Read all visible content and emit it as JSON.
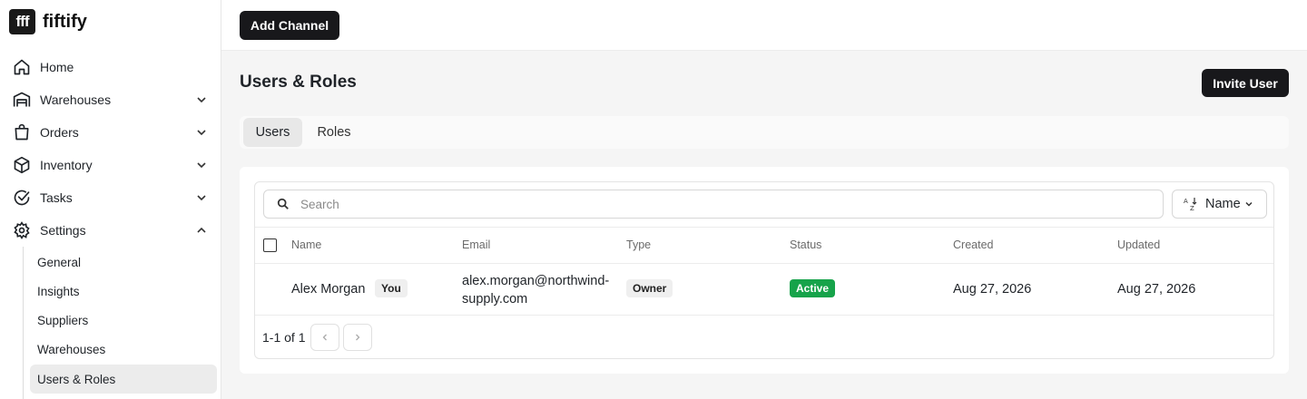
{
  "app": {
    "logo_text": "fff",
    "name": "fiftify"
  },
  "sidebar": {
    "nav": [
      {
        "label": "Home",
        "icon": "home-icon"
      },
      {
        "label": "Warehouses",
        "icon": "warehouse-icon",
        "chevron": "down"
      },
      {
        "label": "Orders",
        "icon": "shopping-bag-icon",
        "chevron": "down"
      },
      {
        "label": "Inventory",
        "icon": "box-icon",
        "chevron": "down"
      },
      {
        "label": "Tasks",
        "icon": "check-circle-icon",
        "chevron": "down"
      },
      {
        "label": "Settings",
        "icon": "gear-icon",
        "chevron": "up"
      }
    ],
    "settings_items": [
      "General",
      "Insights",
      "Suppliers",
      "Warehouses",
      "Users & Roles"
    ],
    "active_item": "Users & Roles"
  },
  "topbar": {
    "add_channel_label": "Add Channel"
  },
  "page": {
    "title": "Users & Roles",
    "invite_label": "Invite User",
    "tabs": [
      {
        "label": "Users",
        "active": true
      },
      {
        "label": "Roles",
        "active": false
      }
    ]
  },
  "table": {
    "search_placeholder": "Search",
    "sort_label": "Name",
    "columns": [
      "Name",
      "Email",
      "Type",
      "Status",
      "Created",
      "Updated"
    ],
    "rows": [
      {
        "name": "Alex Morgan",
        "you_badge": "You",
        "email_line1": "alex.morgan@northwind-",
        "email_line2": "supply.com",
        "type": "Owner",
        "status": "Active",
        "created": "Aug 27, 2026",
        "updated": "Aug 27, 2026"
      }
    ],
    "pagination": "1-1 of 1"
  },
  "colors": {
    "primary_dark": "#18181b",
    "status_active": "#16a34a",
    "active_nav_bg": "#ececec"
  }
}
